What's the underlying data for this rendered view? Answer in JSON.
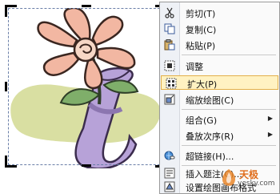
{
  "context_menu": {
    "items": [
      {
        "label": "剪切(T)",
        "icon": "scissors-icon"
      },
      {
        "label": "复制(C)",
        "icon": "copy-icon"
      },
      {
        "label": "粘贴(P)",
        "icon": "paste-icon"
      },
      {
        "label": "调整",
        "icon": "adjust-icon"
      },
      {
        "label": "扩大(P)",
        "icon": "expand-icon",
        "highlighted": true
      },
      {
        "label": "缩放绘图(C)",
        "icon": "zoom-drawing-icon"
      },
      {
        "label": "组合(G)",
        "icon": "group-icon",
        "submenu": true
      },
      {
        "label": "叠放次序(R)",
        "icon": "order-icon",
        "submenu": true
      },
      {
        "label": "超链接(H)...",
        "icon": "hyperlink-icon"
      },
      {
        "label": "插入题注(C)...",
        "icon": "caption-icon"
      },
      {
        "label": "设置绘图画布格式",
        "icon": "format-canvas-icon"
      }
    ]
  },
  "watermark": {
    "brand": "天极",
    "site": "yesky.com"
  },
  "colors": {
    "highlight_bg": "#fff2c2",
    "highlight_border": "#e3b04a",
    "frame": "#6a7fa8"
  }
}
